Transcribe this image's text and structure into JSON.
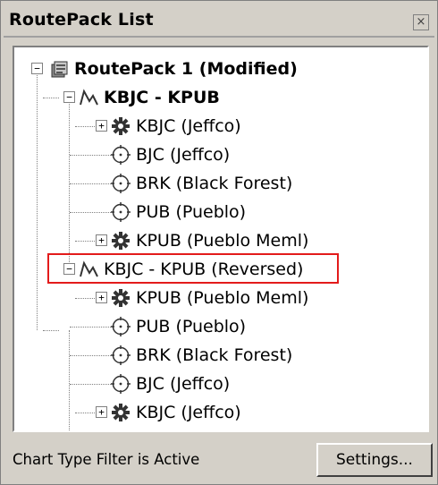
{
  "panel": {
    "title": "RoutePack List",
    "close_label": "×"
  },
  "tree": {
    "routepack": {
      "label": "RoutePack 1 (Modified)",
      "expander": "−"
    },
    "routes": [
      {
        "label": "KBJC - KPUB",
        "expander": "−",
        "children": [
          {
            "type": "airport",
            "label": "KBJC (Jeffco)",
            "expander": "+"
          },
          {
            "type": "waypoint",
            "label": "BJC (Jeffco)"
          },
          {
            "type": "waypoint",
            "label": "BRK (Black Forest)"
          },
          {
            "type": "waypoint",
            "label": "PUB (Pueblo)"
          },
          {
            "type": "airport",
            "label": "KPUB (Pueblo Meml)",
            "expander": "+"
          }
        ]
      },
      {
        "label": "KBJC - KPUB (Reversed)",
        "expander": "−",
        "highlighted": true,
        "children": [
          {
            "type": "airport",
            "label": "KPUB (Pueblo Meml)",
            "expander": "+"
          },
          {
            "type": "waypoint",
            "label": "PUB (Pueblo)"
          },
          {
            "type": "waypoint",
            "label": "BRK (Black Forest)"
          },
          {
            "type": "waypoint",
            "label": "BJC (Jeffco)"
          },
          {
            "type": "airport",
            "label": "KBJC (Jeffco)",
            "expander": "+"
          }
        ]
      }
    ]
  },
  "footer": {
    "status": "Chart Type Filter is Active",
    "settings_label": "Settings..."
  },
  "colors": {
    "highlight_border": "#e31b1b",
    "panel_bg": "#d4d0c8"
  }
}
